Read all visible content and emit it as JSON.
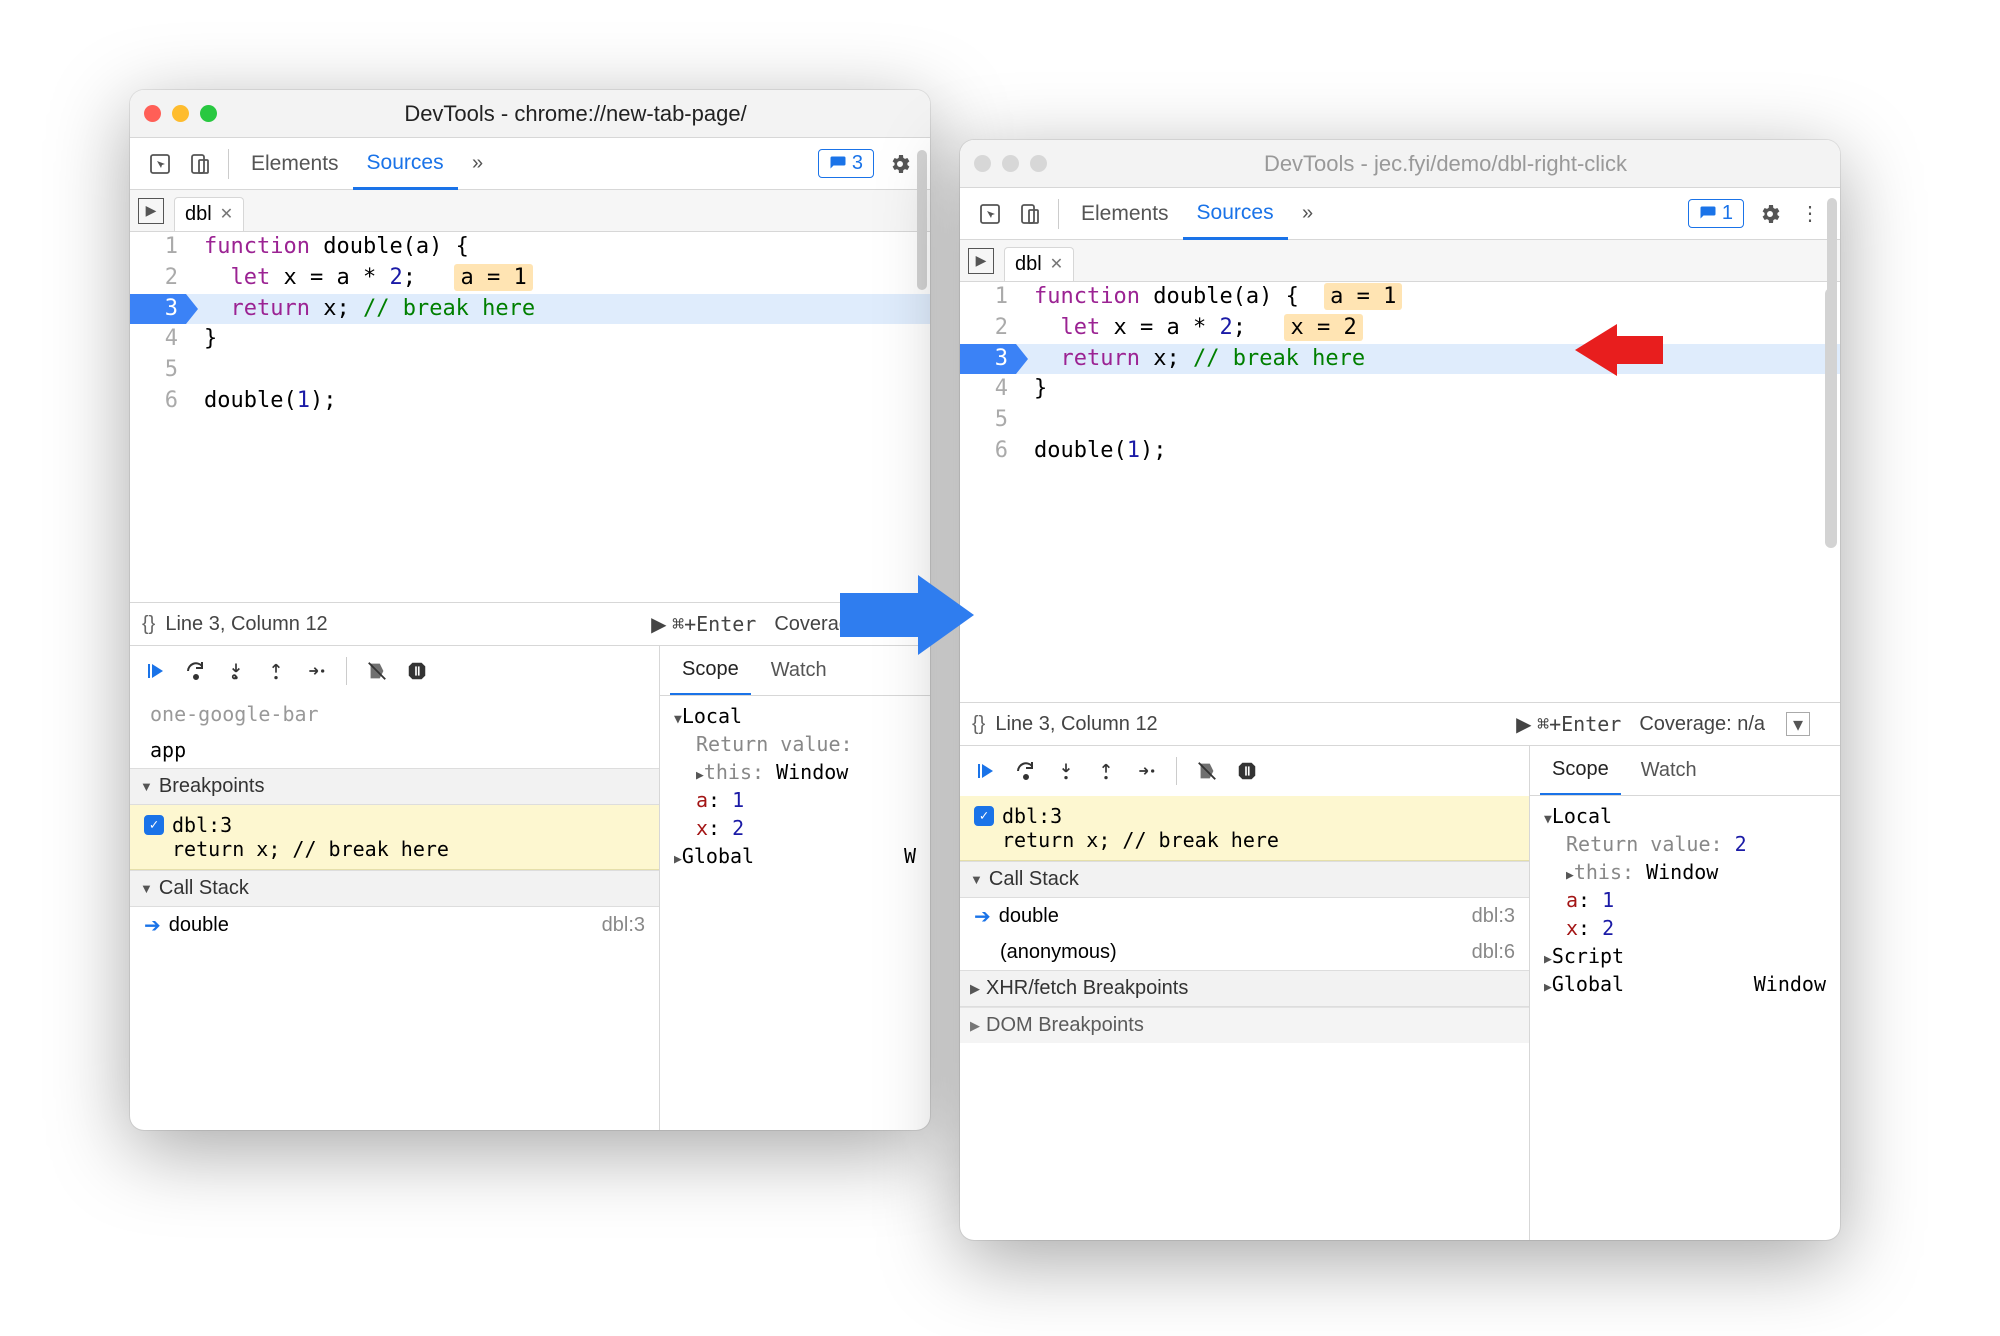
{
  "win1": {
    "title": "DevTools - chrome://new-tab-page/",
    "tabs": {
      "elements": "Elements",
      "sources": "Sources"
    },
    "issues_count": "3",
    "file_tab": "dbl",
    "code": {
      "lines": [
        {
          "n": "1",
          "pre": "function ",
          "kw": false,
          "mid": "double(a) {",
          "inline": ""
        },
        {
          "n": "2",
          "pre": "  ",
          "kw": "let",
          "mid": " x = a * ",
          "num": "2",
          "post": ";",
          "inline": "a = 1"
        },
        {
          "n": "3",
          "pre": "  ",
          "kw": "return",
          "mid": " x; ",
          "com": "// break here",
          "hl": true,
          "bp": true
        },
        {
          "n": "4",
          "pre": "}",
          "mid": ""
        },
        {
          "n": "5",
          "pre": "",
          "mid": ""
        },
        {
          "n": "6",
          "pre": "double(",
          "num": "1",
          "post": ");",
          "mid": ""
        }
      ]
    },
    "status": {
      "pos": "Line 3, Column 12",
      "run": "⌘+Enter",
      "coverage": "Coverage: n/a"
    },
    "sidebar": {
      "app": "app",
      "breakpoints": "Breakpoints",
      "bp_file": "dbl:3",
      "bp_code": "return x; // break here",
      "callstack": "Call Stack",
      "frames": [
        {
          "name": "double",
          "src": "dbl:3",
          "current": true
        }
      ]
    },
    "scope": {
      "tab_scope": "Scope",
      "tab_watch": "Watch",
      "local": "Local",
      "retval_label": "Return value:",
      "retval": "",
      "this_label": "this:",
      "this_val": "Window",
      "vars": [
        {
          "k": "a",
          "v": "1"
        },
        {
          "k": "x",
          "v": "2"
        }
      ],
      "global": "Global",
      "global_val": "W"
    }
  },
  "win2": {
    "title": "DevTools - jec.fyi/demo/dbl-right-click",
    "tabs": {
      "elements": "Elements",
      "sources": "Sources"
    },
    "issues_count": "1",
    "file_tab": "dbl",
    "code": {
      "lines": [
        {
          "n": "1",
          "pre": "function ",
          "mid": "double(a) {",
          "inline": "a = 1"
        },
        {
          "n": "2",
          "pre": "  ",
          "kw": "let",
          "mid": " x = a * ",
          "num": "2",
          "post": ";",
          "inline": "x = 2"
        },
        {
          "n": "3",
          "pre": "  ",
          "kw": "return",
          "mid": " x; ",
          "com": "// break here",
          "hl": true,
          "bp": true
        },
        {
          "n": "4",
          "pre": "}",
          "mid": ""
        },
        {
          "n": "5",
          "pre": "",
          "mid": ""
        },
        {
          "n": "6",
          "pre": "double(",
          "num": "1",
          "post": ");",
          "mid": ""
        }
      ]
    },
    "status": {
      "pos": "Line 3, Column 12",
      "run": "⌘+Enter",
      "coverage": "Coverage: n/a"
    },
    "sidebar": {
      "bp_file": "dbl:3",
      "bp_code": "return x; // break here",
      "callstack": "Call Stack",
      "frames": [
        {
          "name": "double",
          "src": "dbl:3",
          "current": true
        },
        {
          "name": "(anonymous)",
          "src": "dbl:6",
          "current": false
        }
      ],
      "xhr": "XHR/fetch Breakpoints",
      "dom": "DOM Breakpoints"
    },
    "scope": {
      "tab_scope": "Scope",
      "tab_watch": "Watch",
      "local": "Local",
      "retval_label": "Return value:",
      "retval": "2",
      "this_label": "this:",
      "this_val": "Window",
      "vars": [
        {
          "k": "a",
          "v": "1"
        },
        {
          "k": "x",
          "v": "2"
        }
      ],
      "script": "Script",
      "global": "Global",
      "global_val": "Window"
    }
  }
}
